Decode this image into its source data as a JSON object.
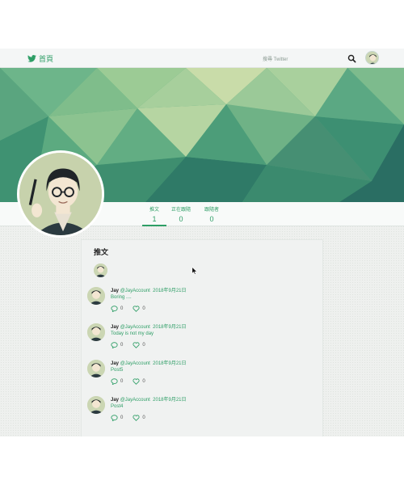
{
  "nav": {
    "home_label": "首頁",
    "search_label": "搜尋 Twitter",
    "icons": {
      "logo": "twitter-bird-icon",
      "search": "search-icon"
    }
  },
  "stats": [
    {
      "label": "推文",
      "value": "1"
    },
    {
      "label": "正在跟隨",
      "value": "0"
    },
    {
      "label": "跟隨者",
      "value": "0"
    }
  ],
  "timeline": {
    "title": "推文",
    "tweets": [
      {
        "name": "Jay",
        "handle": "@JayAccount",
        "date": "2018年9月21日",
        "text": "Boring ....",
        "replies": "0",
        "likes": "0"
      },
      {
        "name": "Jay",
        "handle": "@JayAccount",
        "date": "2018年9月21日",
        "text": "Today is not my day",
        "replies": "0",
        "likes": "0"
      },
      {
        "name": "Jay",
        "handle": "@JayAccount",
        "date": "2018年9月21日",
        "text": "Post5",
        "replies": "0",
        "likes": "0"
      },
      {
        "name": "Jay",
        "handle": "@JayAccount",
        "date": "2018年9月21日",
        "text": "Post4",
        "replies": "0",
        "likes": "0"
      }
    ]
  },
  "colors": {
    "accent": "#2e9e66",
    "banner_dark": "#2f7a67",
    "banner_light": "#c9dca9"
  }
}
